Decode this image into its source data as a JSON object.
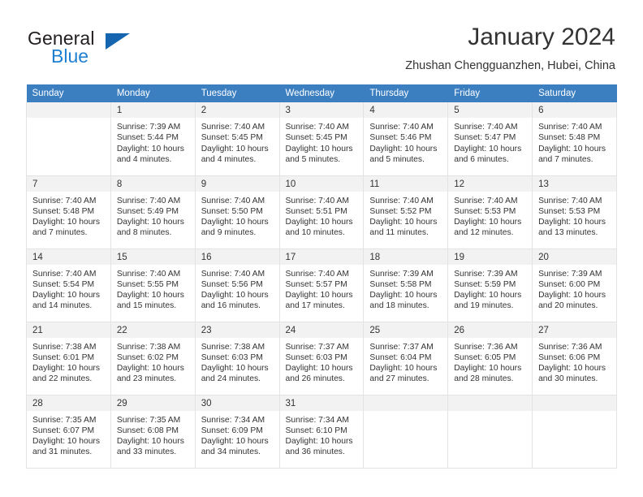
{
  "brand": {
    "name_part1": "General",
    "name_part2": "Blue",
    "triangle_color": "#1565b0"
  },
  "header": {
    "title": "January 2024",
    "subtitle": "Zhushan Chengguanzhen, Hubei, China",
    "header_bg": "#3c7fc1"
  },
  "weekday_headers": [
    "Sunday",
    "Monday",
    "Tuesday",
    "Wednesday",
    "Thursday",
    "Friday",
    "Saturday"
  ],
  "weeks": [
    [
      {
        "day": "",
        "sunrise": "",
        "sunset": "",
        "daylight_line1": "",
        "daylight_line2": "",
        "empty": true
      },
      {
        "day": "1",
        "sunrise": "Sunrise: 7:39 AM",
        "sunset": "Sunset: 5:44 PM",
        "daylight_line1": "Daylight: 10 hours",
        "daylight_line2": "and 4 minutes."
      },
      {
        "day": "2",
        "sunrise": "Sunrise: 7:40 AM",
        "sunset": "Sunset: 5:45 PM",
        "daylight_line1": "Daylight: 10 hours",
        "daylight_line2": "and 4 minutes."
      },
      {
        "day": "3",
        "sunrise": "Sunrise: 7:40 AM",
        "sunset": "Sunset: 5:45 PM",
        "daylight_line1": "Daylight: 10 hours",
        "daylight_line2": "and 5 minutes."
      },
      {
        "day": "4",
        "sunrise": "Sunrise: 7:40 AM",
        "sunset": "Sunset: 5:46 PM",
        "daylight_line1": "Daylight: 10 hours",
        "daylight_line2": "and 5 minutes."
      },
      {
        "day": "5",
        "sunrise": "Sunrise: 7:40 AM",
        "sunset": "Sunset: 5:47 PM",
        "daylight_line1": "Daylight: 10 hours",
        "daylight_line2": "and 6 minutes."
      },
      {
        "day": "6",
        "sunrise": "Sunrise: 7:40 AM",
        "sunset": "Sunset: 5:48 PM",
        "daylight_line1": "Daylight: 10 hours",
        "daylight_line2": "and 7 minutes."
      }
    ],
    [
      {
        "day": "7",
        "sunrise": "Sunrise: 7:40 AM",
        "sunset": "Sunset: 5:48 PM",
        "daylight_line1": "Daylight: 10 hours",
        "daylight_line2": "and 7 minutes."
      },
      {
        "day": "8",
        "sunrise": "Sunrise: 7:40 AM",
        "sunset": "Sunset: 5:49 PM",
        "daylight_line1": "Daylight: 10 hours",
        "daylight_line2": "and 8 minutes."
      },
      {
        "day": "9",
        "sunrise": "Sunrise: 7:40 AM",
        "sunset": "Sunset: 5:50 PM",
        "daylight_line1": "Daylight: 10 hours",
        "daylight_line2": "and 9 minutes."
      },
      {
        "day": "10",
        "sunrise": "Sunrise: 7:40 AM",
        "sunset": "Sunset: 5:51 PM",
        "daylight_line1": "Daylight: 10 hours",
        "daylight_line2": "and 10 minutes."
      },
      {
        "day": "11",
        "sunrise": "Sunrise: 7:40 AM",
        "sunset": "Sunset: 5:52 PM",
        "daylight_line1": "Daylight: 10 hours",
        "daylight_line2": "and 11 minutes."
      },
      {
        "day": "12",
        "sunrise": "Sunrise: 7:40 AM",
        "sunset": "Sunset: 5:53 PM",
        "daylight_line1": "Daylight: 10 hours",
        "daylight_line2": "and 12 minutes."
      },
      {
        "day": "13",
        "sunrise": "Sunrise: 7:40 AM",
        "sunset": "Sunset: 5:53 PM",
        "daylight_line1": "Daylight: 10 hours",
        "daylight_line2": "and 13 minutes."
      }
    ],
    [
      {
        "day": "14",
        "sunrise": "Sunrise: 7:40 AM",
        "sunset": "Sunset: 5:54 PM",
        "daylight_line1": "Daylight: 10 hours",
        "daylight_line2": "and 14 minutes."
      },
      {
        "day": "15",
        "sunrise": "Sunrise: 7:40 AM",
        "sunset": "Sunset: 5:55 PM",
        "daylight_line1": "Daylight: 10 hours",
        "daylight_line2": "and 15 minutes."
      },
      {
        "day": "16",
        "sunrise": "Sunrise: 7:40 AM",
        "sunset": "Sunset: 5:56 PM",
        "daylight_line1": "Daylight: 10 hours",
        "daylight_line2": "and 16 minutes."
      },
      {
        "day": "17",
        "sunrise": "Sunrise: 7:40 AM",
        "sunset": "Sunset: 5:57 PM",
        "daylight_line1": "Daylight: 10 hours",
        "daylight_line2": "and 17 minutes."
      },
      {
        "day": "18",
        "sunrise": "Sunrise: 7:39 AM",
        "sunset": "Sunset: 5:58 PM",
        "daylight_line1": "Daylight: 10 hours",
        "daylight_line2": "and 18 minutes."
      },
      {
        "day": "19",
        "sunrise": "Sunrise: 7:39 AM",
        "sunset": "Sunset: 5:59 PM",
        "daylight_line1": "Daylight: 10 hours",
        "daylight_line2": "and 19 minutes."
      },
      {
        "day": "20",
        "sunrise": "Sunrise: 7:39 AM",
        "sunset": "Sunset: 6:00 PM",
        "daylight_line1": "Daylight: 10 hours",
        "daylight_line2": "and 20 minutes."
      }
    ],
    [
      {
        "day": "21",
        "sunrise": "Sunrise: 7:38 AM",
        "sunset": "Sunset: 6:01 PM",
        "daylight_line1": "Daylight: 10 hours",
        "daylight_line2": "and 22 minutes."
      },
      {
        "day": "22",
        "sunrise": "Sunrise: 7:38 AM",
        "sunset": "Sunset: 6:02 PM",
        "daylight_line1": "Daylight: 10 hours",
        "daylight_line2": "and 23 minutes."
      },
      {
        "day": "23",
        "sunrise": "Sunrise: 7:38 AM",
        "sunset": "Sunset: 6:03 PM",
        "daylight_line1": "Daylight: 10 hours",
        "daylight_line2": "and 24 minutes."
      },
      {
        "day": "24",
        "sunrise": "Sunrise: 7:37 AM",
        "sunset": "Sunset: 6:03 PM",
        "daylight_line1": "Daylight: 10 hours",
        "daylight_line2": "and 26 minutes."
      },
      {
        "day": "25",
        "sunrise": "Sunrise: 7:37 AM",
        "sunset": "Sunset: 6:04 PM",
        "daylight_line1": "Daylight: 10 hours",
        "daylight_line2": "and 27 minutes."
      },
      {
        "day": "26",
        "sunrise": "Sunrise: 7:36 AM",
        "sunset": "Sunset: 6:05 PM",
        "daylight_line1": "Daylight: 10 hours",
        "daylight_line2": "and 28 minutes."
      },
      {
        "day": "27",
        "sunrise": "Sunrise: 7:36 AM",
        "sunset": "Sunset: 6:06 PM",
        "daylight_line1": "Daylight: 10 hours",
        "daylight_line2": "and 30 minutes."
      }
    ],
    [
      {
        "day": "28",
        "sunrise": "Sunrise: 7:35 AM",
        "sunset": "Sunset: 6:07 PM",
        "daylight_line1": "Daylight: 10 hours",
        "daylight_line2": "and 31 minutes."
      },
      {
        "day": "29",
        "sunrise": "Sunrise: 7:35 AM",
        "sunset": "Sunset: 6:08 PM",
        "daylight_line1": "Daylight: 10 hours",
        "daylight_line2": "and 33 minutes."
      },
      {
        "day": "30",
        "sunrise": "Sunrise: 7:34 AM",
        "sunset": "Sunset: 6:09 PM",
        "daylight_line1": "Daylight: 10 hours",
        "daylight_line2": "and 34 minutes."
      },
      {
        "day": "31",
        "sunrise": "Sunrise: 7:34 AM",
        "sunset": "Sunset: 6:10 PM",
        "daylight_line1": "Daylight: 10 hours",
        "daylight_line2": "and 36 minutes."
      },
      {
        "day": "",
        "sunrise": "",
        "sunset": "",
        "daylight_line1": "",
        "daylight_line2": "",
        "empty": true
      },
      {
        "day": "",
        "sunrise": "",
        "sunset": "",
        "daylight_line1": "",
        "daylight_line2": "",
        "empty": true
      },
      {
        "day": "",
        "sunrise": "",
        "sunset": "",
        "daylight_line1": "",
        "daylight_line2": "",
        "empty": true
      }
    ]
  ]
}
